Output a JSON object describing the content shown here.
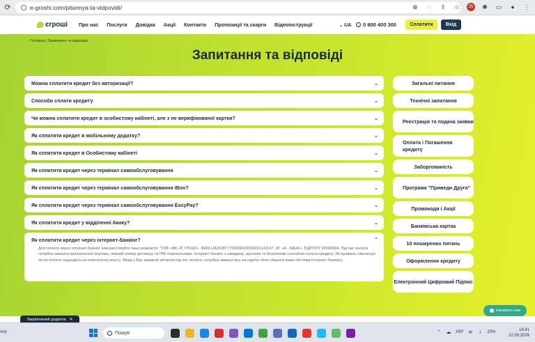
{
  "browser": {
    "url": "e-groshi.com/pitannya-ta-vidpovidi/",
    "extension_badge": "25"
  },
  "header": {
    "logo_text": "єгроші",
    "nav": [
      "Про нас",
      "Послуги",
      "Довідка",
      "Акції",
      "Контакти",
      "Пропозиції та скарги",
      "Відеоінструкції"
    ],
    "lang": "UA",
    "phone": "0 800 400 300",
    "pay_label": "Сплатити",
    "login_label": "Вхід"
  },
  "breadcrumb": "Головна  |  Запитання та відповіді",
  "title": "Запитання та відповіді",
  "faq": [
    {
      "q": "Можна сплатити кредит без авторизації?",
      "open": false
    },
    {
      "q": "Способи сплати кредиту",
      "open": false
    },
    {
      "q": "Чи можна сплатити кредит в особистому кабінеті, але з не верифікованої картки?",
      "open": false
    },
    {
      "q": "Як сплатити кредит в мобільному додатку?",
      "open": false
    },
    {
      "q": "Як сплатити кредит в Особистому кабінеті",
      "open": false
    },
    {
      "q": "Як сплатити кредит через термінал самообслуговування",
      "open": false
    },
    {
      "q": "Як сплатити кредит через термінал самообслуговування IBox?",
      "open": false
    },
    {
      "q": "Як сплатити кредит через термінал самообслуговування EasyPay?",
      "open": false
    },
    {
      "q": "Як сплатити кредит у відділенні банку?",
      "open": false
    },
    {
      "q": "Як сплатити кредит через інтернет-банкінг?",
      "open": true,
      "a": "Для оплати через інтернет-банкінг використовуйте наші реквізити: \"ТОВ «ФК «Є ГРОШІ», IBAN UA263077700000026509011111157, АТ «А - БАНК», ЄДРПОУ 43509084. Під час оплати потрібно вказати призначення платежу, повний номер договору та ПІБ позичальника. Інтернет-банкінг є швидким, зручним та безпечним способом оплати кредиту. Як правило, квитанція після оплати надходить на електронну пошту. Якщо у Вас виникли питання під час оплати, потрібно звернутись на гарячу лінію обраної вами системи інтернет-банкінгу."
    }
  ],
  "categories": [
    {
      "label": "Загальні питання"
    },
    {
      "label": "Технічні запитання"
    },
    {
      "label": "Реєстрація та подача заявки"
    },
    {
      "label": "Оплата і Погашення кредиту"
    },
    {
      "label": "Заборгованість"
    },
    {
      "label": "Програма \"Приведи Друга\""
    },
    {
      "label": "Промокоди і Акції"
    },
    {
      "label": "Банківська картка"
    },
    {
      "label": "10 поширених питань"
    },
    {
      "label": "Оформлення кредиту"
    },
    {
      "label": "Електронний Цифровий Підпис"
    }
  ],
  "chat_label": "Напишіть нам",
  "pinned_tab": "Закріплений додаток",
  "taskbar": {
    "left_text": "nny",
    "search_placeholder": "Пошук",
    "lang": "УКР",
    "battery": "20%",
    "time": "16:41",
    "date": "22.09.2026"
  },
  "colors": {
    "brand_dark": "#1f3a4f",
    "brand_yellow": "#e8f045",
    "brand_green": "#a6d332",
    "chat_green": "#33a88a"
  }
}
